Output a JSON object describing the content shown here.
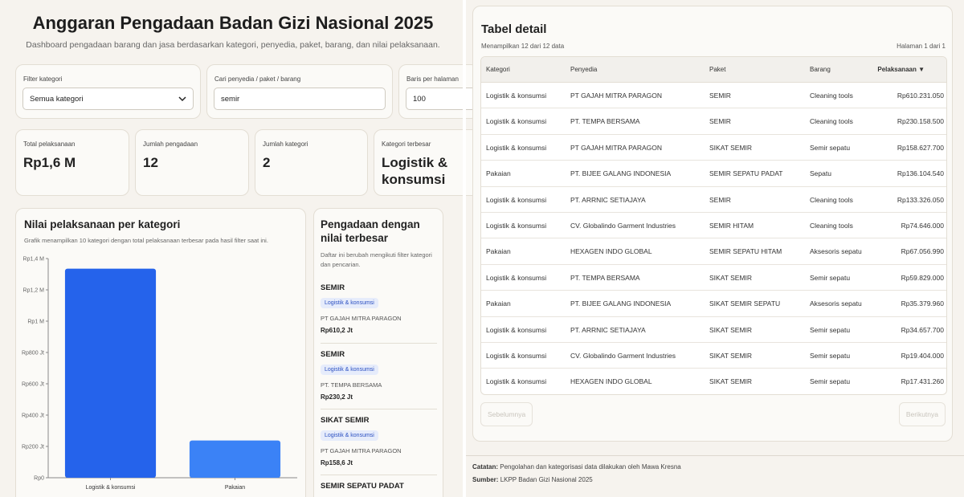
{
  "header": {
    "title": "Anggaran Pengadaan Badan Gizi Nasional 2025",
    "subtitle": "Dashboard pengadaan barang dan jasa berdasarkan kategori, penyedia, paket, barang, dan nilai pelaksanaan."
  },
  "filters": {
    "category_label": "Filter kategori",
    "category_value": "Semua kategori",
    "search_label": "Cari penyedia / paket / barang",
    "search_value": "semir",
    "rows_label": "Baris per halaman",
    "rows_value": "100"
  },
  "stats": [
    {
      "label": "Total pelaksanaan",
      "value": "Rp1,6 M"
    },
    {
      "label": "Jumlah pengadaan",
      "value": "12"
    },
    {
      "label": "Jumlah kategori",
      "value": "2"
    },
    {
      "label": "Kategori terbesar",
      "value": "Logistik & konsumsi"
    }
  ],
  "chart_data": {
    "type": "bar",
    "title": "Nilai pelaksanaan per kategori",
    "subtitle": "Grafik menampilkan 10 kategori dengan total pelaksanaan terbesar pada hasil filter saat ini.",
    "categories": [
      "Logistik & konsumsi",
      "Pakaian"
    ],
    "values": [
      1335000000,
      238000000
    ],
    "ylim": [
      0,
      1400000000
    ],
    "yticks": [
      0,
      200000000,
      400000000,
      600000000,
      800000000,
      1000000000,
      1200000000,
      1400000000
    ],
    "ytick_labels": [
      "Rp0",
      "Rp200 Jt",
      "Rp400 Jt",
      "Rp600 Jt",
      "Rp800 Jt",
      "Rp1 M",
      "Rp1,2 M",
      "Rp1,4 M"
    ],
    "grid": false,
    "colors": [
      "#2563eb",
      "#3b82f6"
    ]
  },
  "top_list": {
    "title": "Pengadaan dengan nilai terbesar",
    "desc": "Daftar ini berubah mengikuti filter kategori dan pencarian.",
    "items": [
      {
        "name": "SEMIR",
        "category": "Logistik & konsumsi",
        "provider": "PT GAJAH MITRA PARAGON",
        "value": "Rp610,2 Jt"
      },
      {
        "name": "SEMIR",
        "category": "Logistik & konsumsi",
        "provider": "PT. TEMPA BERSAMA",
        "value": "Rp230,2 Jt"
      },
      {
        "name": "SIKAT SEMIR",
        "category": "Logistik & konsumsi",
        "provider": "PT GAJAH MITRA PARAGON",
        "value": "Rp158,6 Jt"
      },
      {
        "name": "SEMIR SEPATU PADAT"
      }
    ]
  },
  "table": {
    "title": "Tabel detail",
    "info": "Menampilkan 12 dari 12 data",
    "page": "Halaman 1 dari 1",
    "columns": [
      "Kategori",
      "Penyedia",
      "Paket",
      "Barang",
      "Pelaksanaan ▼"
    ],
    "rows": [
      [
        "Logistik & konsumsi",
        "PT GAJAH MITRA PARAGON",
        "SEMIR",
        "Cleaning tools",
        "Rp610.231.050"
      ],
      [
        "Logistik & konsumsi",
        "PT. TEMPA BERSAMA",
        "SEMIR",
        "Cleaning tools",
        "Rp230.158.500"
      ],
      [
        "Logistik & konsumsi",
        "PT GAJAH MITRA PARAGON",
        "SIKAT SEMIR",
        "Semir sepatu",
        "Rp158.627.700"
      ],
      [
        "Pakaian",
        "PT. BIJEE GALANG INDONESIA",
        "SEMIR SEPATU PADAT",
        "Sepatu",
        "Rp136.104.540"
      ],
      [
        "Logistik & konsumsi",
        "PT. ARRNIC SETIAJAYA",
        "SEMIR",
        "Cleaning tools",
        "Rp133.326.050"
      ],
      [
        "Logistik & konsumsi",
        "CV. Globalindo Garment Industries",
        "SEMIR HITAM",
        "Cleaning tools",
        "Rp74.646.000"
      ],
      [
        "Pakaian",
        "HEXAGEN INDO GLOBAL",
        "SEMIR SEPATU HITAM",
        "Aksesoris sepatu",
        "Rp67.056.990"
      ],
      [
        "Logistik & konsumsi",
        "PT. TEMPA BERSAMA",
        "SIKAT SEMIR",
        "Semir sepatu",
        "Rp59.829.000"
      ],
      [
        "Pakaian",
        "PT. BIJEE GALANG INDONESIA",
        "SIKAT SEMIR SEPATU",
        "Aksesoris sepatu",
        "Rp35.379.960"
      ],
      [
        "Logistik & konsumsi",
        "PT. ARRNIC SETIAJAYA",
        "SIKAT SEMIR",
        "Semir sepatu",
        "Rp34.657.700"
      ],
      [
        "Logistik & konsumsi",
        "CV. Globalindo Garment Industries",
        "SIKAT SEMIR",
        "Semir sepatu",
        "Rp19.404.000"
      ],
      [
        "Logistik & konsumsi",
        "HEXAGEN INDO GLOBAL",
        "SIKAT SEMIR",
        "Semir sepatu",
        "Rp17.431.260"
      ]
    ],
    "prev_label": "Sebelumnya",
    "next_label": "Berikutnya"
  },
  "footer": {
    "note_label": "Catatan:",
    "note_text": "Pengolahan dan kategorisasi data dilakukan oleh Mawa Kresna",
    "source_label": "Sumber:",
    "source_text": "LKPP Badan Gizi Nasional 2025"
  }
}
